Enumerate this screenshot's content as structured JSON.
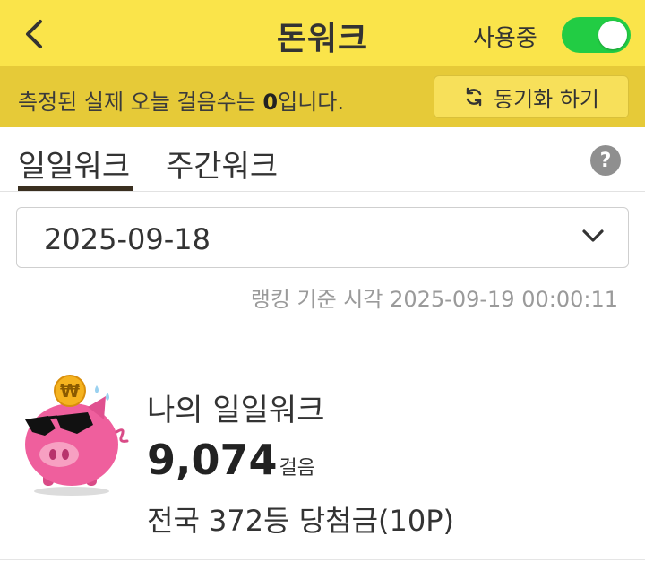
{
  "header": {
    "title": "돈워크",
    "status_label": "사용중",
    "toggle_on": true,
    "back_icon": "chevron-left-icon",
    "background": "#fae44a"
  },
  "subbar": {
    "message_prefix": "측정된 실제 오늘 걸음수는 ",
    "message_count": "0",
    "message_suffix": "입니다.",
    "sync_label": "동기화 하기",
    "sync_icon": "refresh-icon",
    "background": "#e6ca38"
  },
  "tabs": [
    {
      "label": "일일워크",
      "active": true
    },
    {
      "label": "주간워크",
      "active": false
    }
  ],
  "help_glyph": "?",
  "date_select": {
    "value": "2025-09-18",
    "icon": "chevron-down-icon"
  },
  "ranking_time": "랭킹 기준 시각 2025-09-19 00:00:11",
  "mascot": {
    "coin_symbol": "₩",
    "colors": {
      "pig": "#ef5f9d",
      "coin": "#f5b31f"
    }
  },
  "my_walk": {
    "title": "나의 일일워크",
    "steps": "9,074",
    "steps_unit": "걸음",
    "rank_text": "전국 372등 당첨금(10P)"
  },
  "colors": {
    "toggle_on": "#22cc44",
    "tab_indicator": "#3a2f20"
  }
}
